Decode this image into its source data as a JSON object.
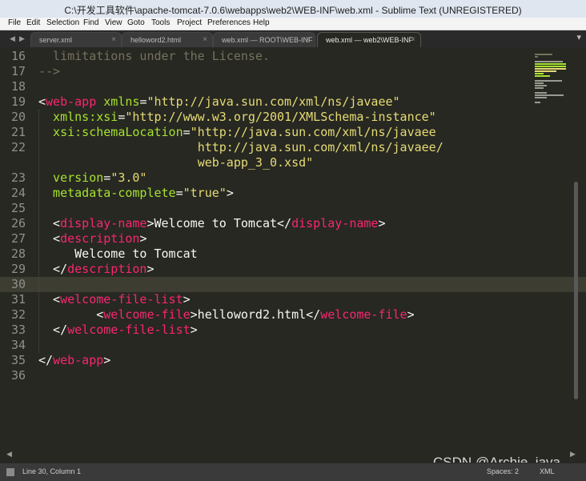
{
  "window": {
    "title": "C:\\开发工具软件\\apache-tomcat-7.0.6\\webapps\\web2\\WEB-INF\\web.xml - Sublime Text (UNREGISTERED)"
  },
  "menu": [
    "File",
    "Edit",
    "Selection",
    "Find",
    "View",
    "Goto",
    "Tools",
    "Project",
    "Preferences",
    "Help"
  ],
  "tabs": [
    {
      "label": "server.xml",
      "close": "×"
    },
    {
      "label": "helloword2.html",
      "close": "×"
    },
    {
      "label": "web.xml — ROOT\\WEB-INF",
      "close": "×"
    },
    {
      "label": "web.xml — web2\\WEB-INF",
      "close": "×",
      "active": true
    }
  ],
  "tab_nav": {
    "left": "◀",
    "right": "▶",
    "overflow": "▾"
  },
  "editor": {
    "current_line": 30,
    "lines": [
      {
        "n": "16",
        "tokens": [
          {
            "t": "  limitations under the License.",
            "c": "comment"
          }
        ]
      },
      {
        "n": "17",
        "tokens": [
          {
            "t": "-->",
            "c": "comment"
          }
        ]
      },
      {
        "n": "18",
        "tokens": []
      },
      {
        "n": "19",
        "tokens": [
          {
            "t": "<",
            "c": "text"
          },
          {
            "t": "web-app",
            "c": "tag"
          },
          {
            "t": " xmlns",
            "c": "attr"
          },
          {
            "t": "=",
            "c": "text"
          },
          {
            "t": "\"http://java.sun.com/xml/ns/javaee\"",
            "c": "str"
          }
        ]
      },
      {
        "n": "20",
        "tokens": [
          {
            "t": "  xmlns:xsi",
            "c": "attr"
          },
          {
            "t": "=",
            "c": "text"
          },
          {
            "t": "\"http://www.w3.org/2001/XMLSchema-instance\"",
            "c": "str"
          }
        ]
      },
      {
        "n": "21",
        "tokens": [
          {
            "t": "  xsi:schemaLocation",
            "c": "attr"
          },
          {
            "t": "=",
            "c": "text"
          },
          {
            "t": "\"http://java.sun.com/xml/ns/javaee",
            "c": "str"
          }
        ]
      },
      {
        "n": "22",
        "tokens": [
          {
            "t": "                      ",
            "c": "text"
          },
          {
            "t": "http://java.sun.com/xml/ns/javaee/",
            "c": "str"
          }
        ]
      },
      {
        "n": "",
        "tokens": [
          {
            "t": "                      ",
            "c": "text"
          },
          {
            "t": "web-app_3_0.xsd\"",
            "c": "str"
          }
        ]
      },
      {
        "n": "23",
        "tokens": [
          {
            "t": "  version",
            "c": "attr"
          },
          {
            "t": "=",
            "c": "text"
          },
          {
            "t": "\"3.0\"",
            "c": "str"
          }
        ]
      },
      {
        "n": "24",
        "tokens": [
          {
            "t": "  metadata-complete",
            "c": "attr"
          },
          {
            "t": "=",
            "c": "text"
          },
          {
            "t": "\"true\"",
            "c": "str"
          },
          {
            "t": ">",
            "c": "text"
          }
        ]
      },
      {
        "n": "25",
        "tokens": []
      },
      {
        "n": "26",
        "tokens": [
          {
            "t": "  <",
            "c": "text"
          },
          {
            "t": "display-name",
            "c": "tag"
          },
          {
            "t": ">Welcome to Tomcat</",
            "c": "text"
          },
          {
            "t": "display-name",
            "c": "tag"
          },
          {
            "t": ">",
            "c": "text"
          }
        ]
      },
      {
        "n": "27",
        "tokens": [
          {
            "t": "  <",
            "c": "text"
          },
          {
            "t": "description",
            "c": "tag"
          },
          {
            "t": ">",
            "c": "text"
          }
        ]
      },
      {
        "n": "28",
        "tokens": [
          {
            "t": "     Welcome to Tomcat",
            "c": "text"
          }
        ]
      },
      {
        "n": "29",
        "tokens": [
          {
            "t": "  </",
            "c": "text"
          },
          {
            "t": "description",
            "c": "tag"
          },
          {
            "t": ">",
            "c": "text"
          }
        ]
      },
      {
        "n": "30",
        "tokens": []
      },
      {
        "n": "31",
        "tokens": [
          {
            "t": "  <",
            "c": "text"
          },
          {
            "t": "welcome-file-list",
            "c": "tag"
          },
          {
            "t": ">",
            "c": "text"
          }
        ]
      },
      {
        "n": "32",
        "tokens": [
          {
            "t": "        <",
            "c": "text"
          },
          {
            "t": "welcome-file",
            "c": "tag"
          },
          {
            "t": ">helloword2.html</",
            "c": "text"
          },
          {
            "t": "welcome-file",
            "c": "tag"
          },
          {
            "t": ">",
            "c": "text"
          }
        ]
      },
      {
        "n": "33",
        "tokens": [
          {
            "t": "  </",
            "c": "text"
          },
          {
            "t": "welcome-file-list",
            "c": "tag"
          },
          {
            "t": ">",
            "c": "text"
          }
        ]
      },
      {
        "n": "34",
        "tokens": []
      },
      {
        "n": "35",
        "tokens": [
          {
            "t": "</",
            "c": "text"
          },
          {
            "t": "web-app",
            "c": "tag"
          },
          {
            "t": ">",
            "c": "text"
          }
        ]
      },
      {
        "n": "36",
        "tokens": []
      }
    ]
  },
  "scroll": {
    "left": "◀",
    "right": "▶"
  },
  "watermark": "CSDN @Archie_java",
  "status": {
    "position": "Line 30, Column 1",
    "spaces": "Spaces: 2",
    "syntax": "XML"
  },
  "colors": {
    "background": "#272822",
    "tag": "#f92672",
    "attribute": "#a6e22e",
    "string": "#e6db74",
    "comment": "#75715e",
    "text": "#f8f8f2",
    "line_number": "#8f908a"
  }
}
